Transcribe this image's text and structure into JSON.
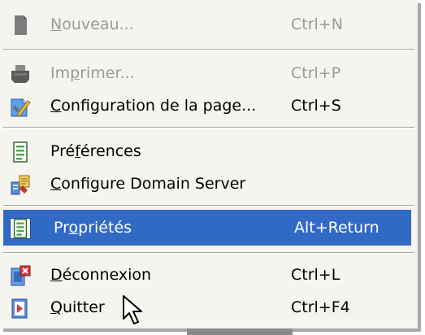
{
  "menu": {
    "items": [
      {
        "pre": "",
        "mn": "N",
        "post": "ouveau...",
        "shortcut": "Ctrl+N",
        "icon": "document-gray-icon",
        "state": "disabled"
      },
      {
        "pre": "Im",
        "mn": "p",
        "post": "rimer...",
        "shortcut": "Ctrl+P",
        "icon": "printer-gray-icon",
        "state": "disabled"
      },
      {
        "pre": "",
        "mn": "C",
        "post": "onfiguration de la page...",
        "shortcut": "Ctrl+S",
        "icon": "page-setup-icon",
        "state": "normal"
      },
      {
        "pre": "Pré",
        "mn": "f",
        "post": "érences",
        "shortcut": "",
        "icon": "preferences-icon",
        "state": "normal"
      },
      {
        "pre": "",
        "mn": "C",
        "post": "onfigure Domain Server",
        "shortcut": "",
        "icon": "domain-server-icon",
        "state": "normal"
      },
      {
        "pre": "Pr",
        "mn": "o",
        "post": "priétés",
        "shortcut": "Alt+Return",
        "icon": "properties-icon",
        "state": "highlighted"
      },
      {
        "pre": "",
        "mn": "D",
        "post": "éconnexion",
        "shortcut": "Ctrl+L",
        "icon": "logout-icon",
        "state": "normal"
      },
      {
        "pre": "",
        "mn": "Q",
        "post": "uitter",
        "shortcut": "Ctrl+F4",
        "icon": "exit-icon",
        "state": "normal"
      }
    ]
  },
  "colors": {
    "menu_background": "#f5f4ee",
    "highlight": "#316ac5",
    "disabled_text": "#9a9a9a",
    "separator": "#a7a6aa"
  }
}
